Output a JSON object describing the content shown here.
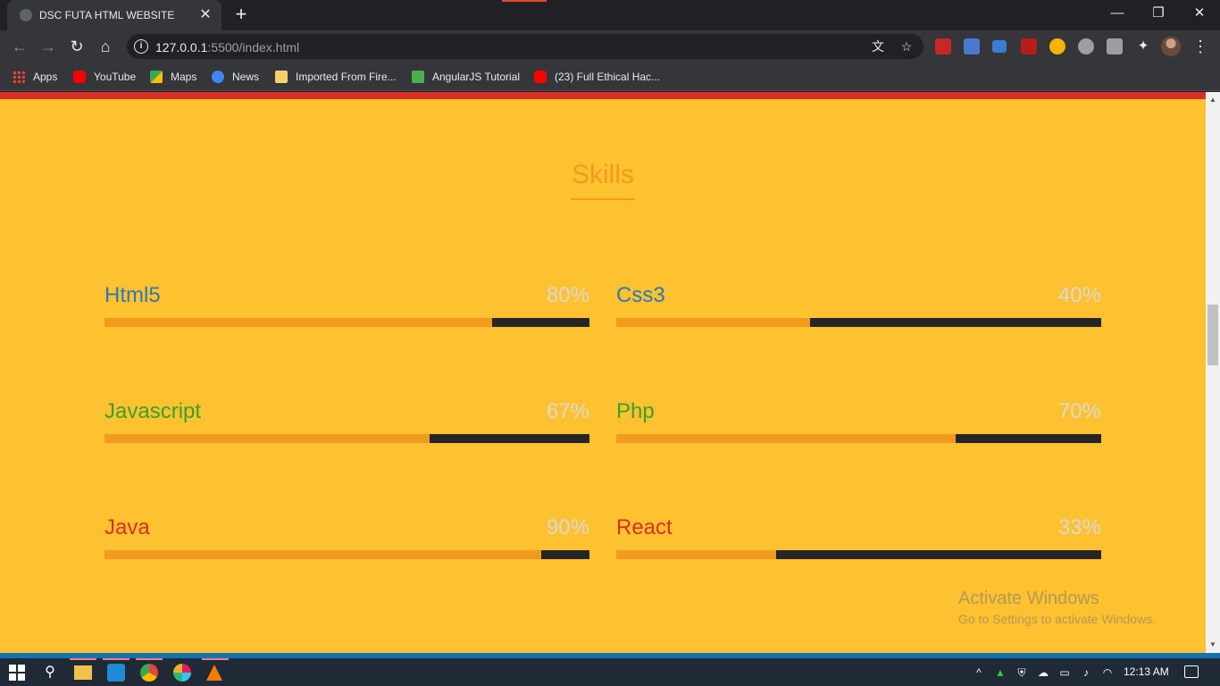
{
  "browser": {
    "tab_title": "DSC FUTA HTML WEBSITE",
    "tab_close": "✕",
    "new_tab": "+",
    "window_controls": {
      "minimize": "—",
      "restore": "❐",
      "close": "✕"
    },
    "url_host": "127.0.0.1",
    "url_path": ":5500/index.html",
    "menu": "⋮"
  },
  "bookmarks": [
    {
      "label": "Apps",
      "icon": "apps-grid-icon",
      "color": "#ea4335"
    },
    {
      "label": "YouTube",
      "icon": "youtube-icon",
      "color": "#ff0000"
    },
    {
      "label": "Maps",
      "icon": "maps-icon",
      "color": "#34a853"
    },
    {
      "label": "News",
      "icon": "news-icon",
      "color": "#4285f4"
    },
    {
      "label": "Imported From Fire...",
      "icon": "folder-icon",
      "color": "#f6d06a"
    },
    {
      "label": "AngularJS Tutorial",
      "icon": "angular-tutorial-icon",
      "color": "#4caf50"
    },
    {
      "label": "(23) Full Ethical Hac...",
      "icon": "youtube-icon",
      "color": "#ff0000"
    }
  ],
  "page": {
    "section_title": "Skills",
    "skills": [
      {
        "name": "Html5",
        "percent_label": "80%",
        "level": 0.8,
        "name_color": "#2a7ab8"
      },
      {
        "name": "Css3",
        "percent_label": "40%",
        "level": 0.4,
        "name_color": "#2a7ab8"
      },
      {
        "name": "Javascript",
        "percent_label": "67%",
        "level": 0.67,
        "name_color": "#3aa12f"
      },
      {
        "name": "Php",
        "percent_label": "70%",
        "level": 0.7,
        "name_color": "#3aa12f"
      },
      {
        "name": "Java",
        "percent_label": "90%",
        "level": 0.9,
        "name_color": "#d93025"
      },
      {
        "name": "React",
        "percent_label": "33%",
        "level": 0.33,
        "name_color": "#d93025"
      }
    ],
    "watermark_title": "Activate Windows",
    "watermark_sub": "Go to Settings to activate Windows."
  },
  "taskbar": {
    "clock": "12:13 AM",
    "apps": [
      "start-icon",
      "search-icon",
      "file-explorer-icon",
      "vscode-icon",
      "chrome-icon",
      "slack-icon",
      "vlc-icon"
    ]
  }
}
